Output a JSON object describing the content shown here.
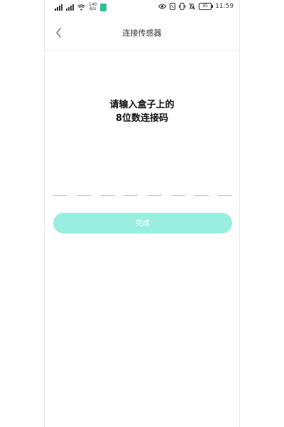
{
  "status_bar": {
    "network_speed_value": "140",
    "network_speed_unit": "B/s",
    "battery_level": "85",
    "time": "11:59"
  },
  "nav": {
    "title": "连接传感器"
  },
  "prompt": {
    "line1": "请输入盒子上的",
    "line2": "8位数连接码"
  },
  "code_input": {
    "digits": [
      "",
      "",
      "",
      "",
      "",
      "",
      "",
      ""
    ]
  },
  "actions": {
    "done_label": "完成"
  },
  "colors": {
    "button_bg": "#9aeee0",
    "button_text": "#ffffff",
    "title_text": "#333333",
    "slot_underline": "#bdbdbd"
  },
  "icons": {
    "back": "chevron-left-icon"
  }
}
